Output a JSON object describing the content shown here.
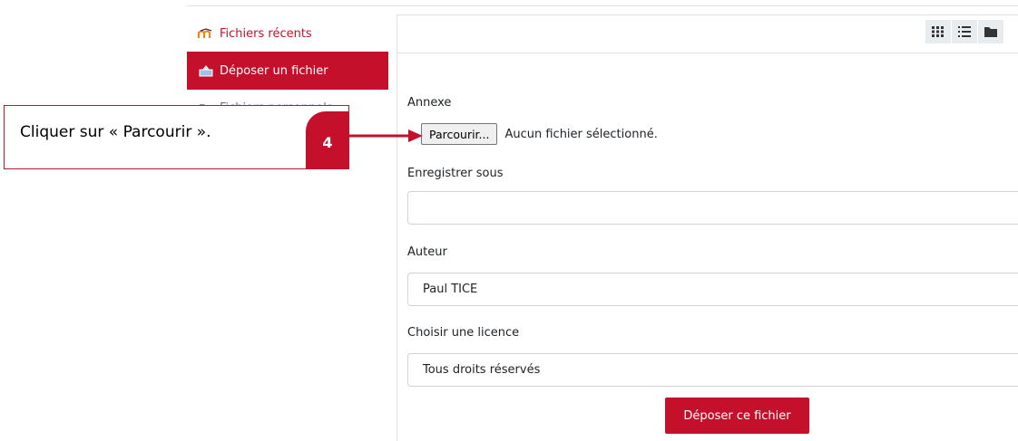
{
  "sidebar": {
    "items": [
      {
        "label": "Fichiers récents",
        "icon": "moodle-icon"
      },
      {
        "label": "Déposer un fichier",
        "icon": "upload-icon"
      },
      {
        "label": "Fichiers personnels",
        "icon": "folder-icon"
      }
    ]
  },
  "toolbar": {
    "views": [
      "grid-view-icon",
      "list-view-icon",
      "tree-view-icon"
    ]
  },
  "form": {
    "attachment_label": "Annexe",
    "browse_label": "Parcourir...",
    "file_status": "Aucun fichier sélectionné.",
    "save_as_label": "Enregistrer sous",
    "save_as_value": "",
    "author_label": "Auteur",
    "author_value": "Paul TICE",
    "license_label": "Choisir une licence",
    "license_value": "Tous droits réservés",
    "submit_label": "Déposer ce fichier"
  },
  "callout": {
    "text": "Cliquer sur « Parcourir ».",
    "step": "4"
  },
  "colors": {
    "accent": "#c4102b",
    "border": "#dee2e6"
  }
}
